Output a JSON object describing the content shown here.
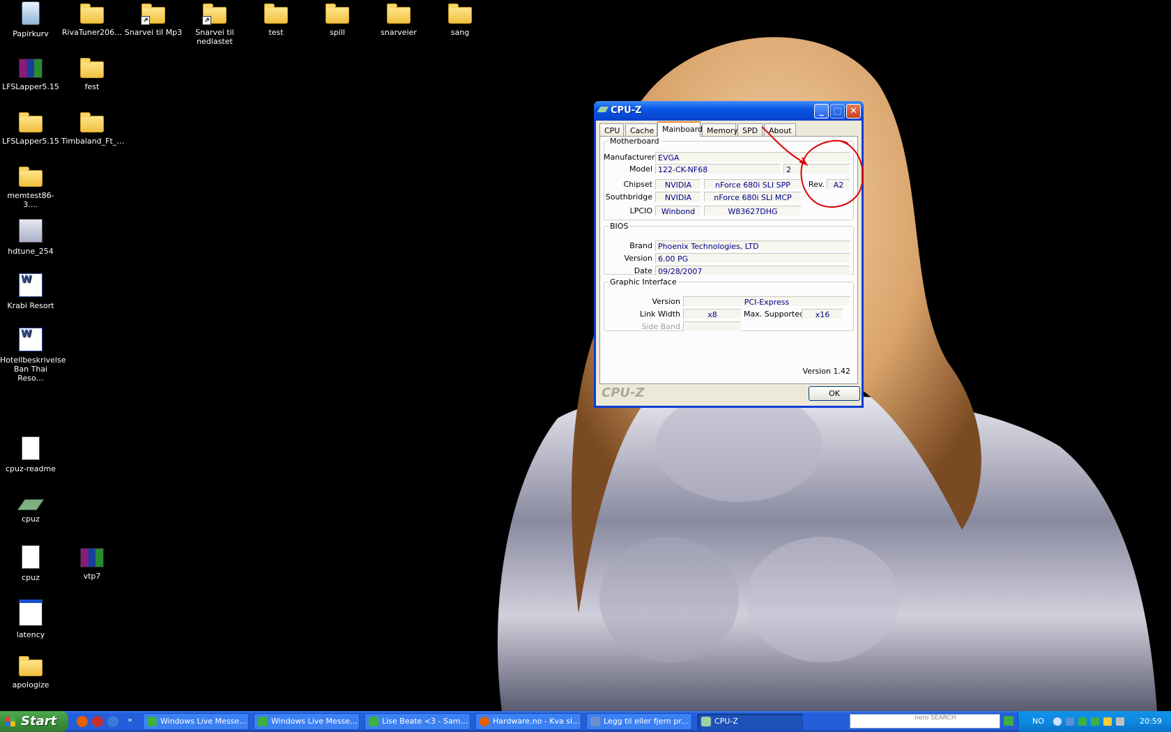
{
  "desktop_icons": [
    {
      "id": "papirkurv",
      "label": "Papirkurv",
      "kind": "bin",
      "icon": "recycle-bin-icon"
    },
    {
      "id": "rivatuner",
      "label": "RivaTuner206…",
      "kind": "folder",
      "icon": "folder-icon"
    },
    {
      "id": "snarvei-mp3",
      "label": "Snarvei til Mp3",
      "kind": "folder shortcut",
      "icon": "folder-shortcut-icon"
    },
    {
      "id": "snarvei-nedlastet",
      "label": "Snarvei til nedlastet",
      "kind": "folder shortcut",
      "icon": "folder-shortcut-icon"
    },
    {
      "id": "test",
      "label": "test",
      "kind": "folder",
      "icon": "folder-icon"
    },
    {
      "id": "spill",
      "label": "spill",
      "kind": "folder",
      "icon": "folder-icon"
    },
    {
      "id": "snarveier",
      "label": "snarveier",
      "kind": "folder",
      "icon": "folder-icon"
    },
    {
      "id": "sang",
      "label": "sang",
      "kind": "folder",
      "icon": "folder-icon"
    },
    {
      "id": "lfslapper-rar",
      "label": "LFSLapper5.15",
      "kind": "rar",
      "icon": "winrar-archive-icon"
    },
    {
      "id": "fest",
      "label": "fest",
      "kind": "folder",
      "icon": "folder-icon"
    },
    {
      "id": "lfslapper-folder",
      "label": "LFSLapper5.15",
      "kind": "folder",
      "icon": "folder-icon"
    },
    {
      "id": "timbaland",
      "label": "Timbaland_Ft_…",
      "kind": "folder",
      "icon": "folder-icon"
    },
    {
      "id": "memtest",
      "label": "memtest86-3.…",
      "kind": "folder",
      "icon": "folder-icon"
    },
    {
      "id": "hdtune",
      "label": "hdtune_254",
      "kind": "exe",
      "icon": "installer-icon"
    },
    {
      "id": "krabi",
      "label": "Krabi Resort",
      "kind": "word",
      "icon": "word-document-icon"
    },
    {
      "id": "hotell",
      "label": "Hotellbeskrivelse Ban Thai Reso…",
      "kind": "word",
      "icon": "word-document-icon"
    },
    {
      "id": "cpuz-readme",
      "label": "cpuz-readme",
      "kind": "doc",
      "icon": "text-document-icon"
    },
    {
      "id": "cpuz-app",
      "label": "cpuz",
      "kind": "chip",
      "icon": "cpuz-chip-icon"
    },
    {
      "id": "cpuz-cfg",
      "label": "cpuz",
      "kind": "doc",
      "icon": "config-file-icon"
    },
    {
      "id": "vtp7",
      "label": "vtp7",
      "kind": "rar",
      "icon": "winrar-archive-icon"
    },
    {
      "id": "latency",
      "label": "latency",
      "kind": "app",
      "icon": "application-window-icon"
    },
    {
      "id": "apologize",
      "label": "apologize",
      "kind": "folder",
      "icon": "folder-icon"
    }
  ],
  "cpuz": {
    "title": "CPU-Z",
    "tabs": [
      "CPU",
      "Cache",
      "Mainboard",
      "Memory",
      "SPD",
      "About"
    ],
    "active_tab": "Mainboard",
    "motherboard": {
      "legend": "Motherboard",
      "manufacturer_label": "Manufacturer",
      "manufacturer": "EVGA",
      "model_label": "Model",
      "model": "122-CK-NF68",
      "model_rev": "2",
      "chipset_label": "Chipset",
      "chipset_vendor": "NVIDIA",
      "chipset_name": "nForce 680i SLI SPP",
      "rev_label": "Rev.",
      "rev": "A2",
      "southbridge_label": "Southbridge",
      "southbridge_vendor": "NVIDIA",
      "southbridge_name": "nForce 680i SLI MCP",
      "lpcio_label": "LPCIO",
      "lpcio_vendor": "Winbond",
      "lpcio_name": "W83627DHG"
    },
    "bios": {
      "legend": "BIOS",
      "brand_label": "Brand",
      "brand": "Phoenix Technologies, LTD",
      "version_label": "Version",
      "version": "6.00 PG",
      "date_label": "Date",
      "date": "09/28/2007"
    },
    "graphic": {
      "legend": "Graphic Interface",
      "version_label": "Version",
      "version": "PCI-Express",
      "link_width_label": "Link Width",
      "link_width": "x8",
      "max_supported_label": "Max. Supported",
      "max_supported": "x16",
      "side_band_label": "Side Band"
    },
    "version_text": "Version 1.42",
    "brand_text": "CPU-Z",
    "ok_label": "OK",
    "annotation_color": "#e00000"
  },
  "taskbar": {
    "start_label": "Start",
    "tasks": [
      {
        "label": "Windows Live Messen…",
        "icon": "messenger-icon",
        "color": "#3cb043"
      },
      {
        "label": "Windows Live Messen…",
        "icon": "messenger-icon",
        "color": "#3cb043"
      },
      {
        "label": "Lise Beate <3 - Samtale",
        "icon": "messenger-chat-icon",
        "color": "#3cb043"
      },
      {
        "label": "Hardware.no - Kva sl…",
        "icon": "firefox-icon",
        "color": "#e66000"
      },
      {
        "label": "Legg til eller fjern pro…",
        "icon": "control-panel-icon",
        "color": "#6b8fd0"
      },
      {
        "label": "CPU-Z",
        "icon": "cpuz-icon",
        "color": "#9fd09f",
        "active": true
      }
    ],
    "search_brand": "nero SEARCH",
    "language": "NO",
    "clock": "20:59"
  }
}
